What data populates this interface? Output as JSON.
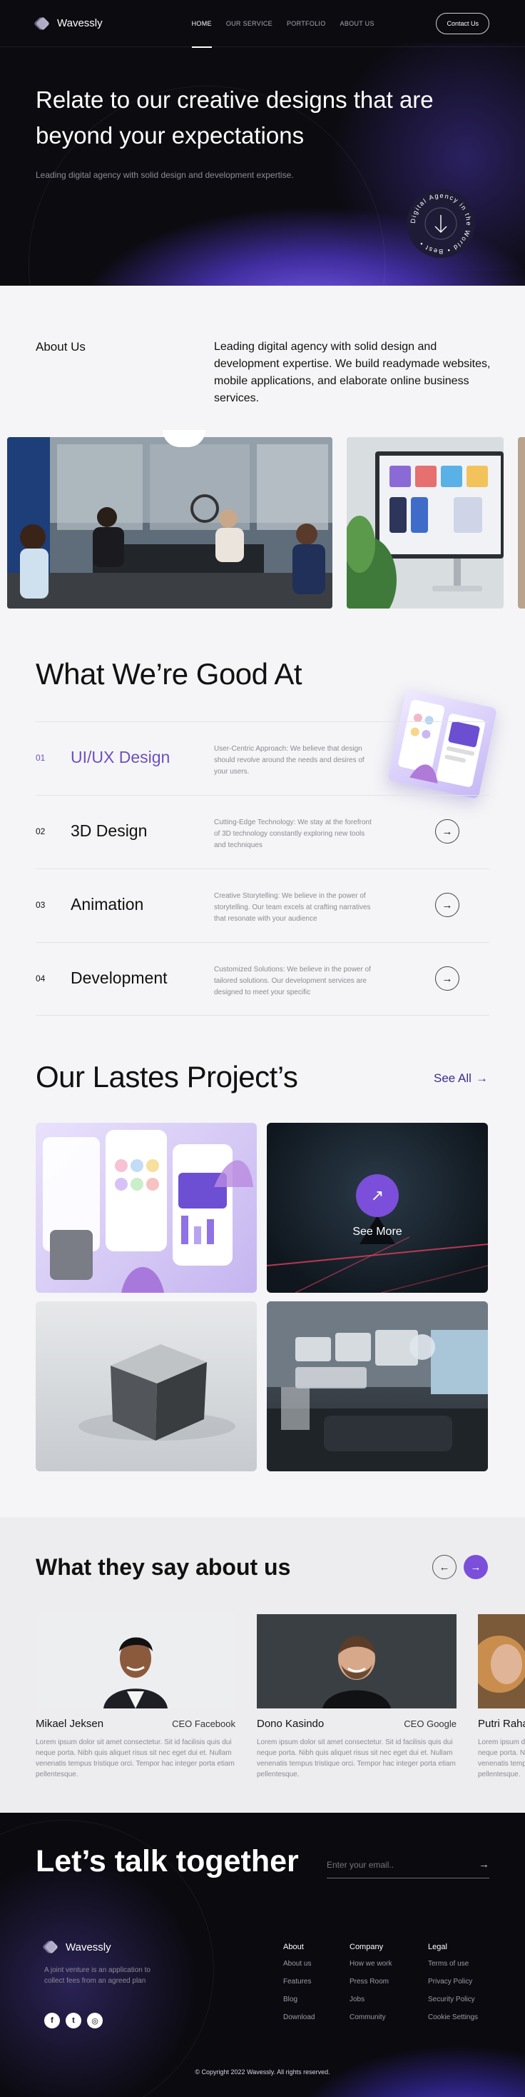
{
  "brand": {
    "name": "Wavessly"
  },
  "nav": {
    "items": [
      {
        "label": "HOME",
        "active": true
      },
      {
        "label": "OUR SERVICE",
        "active": false
      },
      {
        "label": "PORTFOLIO",
        "active": false
      },
      {
        "label": "ABOUT US",
        "active": false
      }
    ],
    "contact_label": "Contact Us"
  },
  "hero": {
    "title": "Relate to our creative designs that are beyond your expectations",
    "subtitle": "Leading digital agency with solid design and development expertise.",
    "badge_text": "Digital Agency in the World • Best •"
  },
  "about": {
    "label": "About Us",
    "text": "Leading digital agency with solid design and development expertise. We build readymade websites, mobile applications, and elaborate online business services."
  },
  "services": {
    "title": "What We’re Good At",
    "items": [
      {
        "num": "01",
        "name": "UI/UX Design",
        "desc": "User-Centric Approach: We believe that design should revolve around the needs and desires of your users.",
        "active": true
      },
      {
        "num": "02",
        "name": "3D Design",
        "desc": "Cutting-Edge Technology: We stay at the forefront of 3D technology constantly exploring new tools and techniques",
        "active": false
      },
      {
        "num": "03",
        "name": "Animation",
        "desc": "Creative Storytelling: We believe in the power of storytelling. Our team excels at crafting narratives that resonate with your audience",
        "active": false
      },
      {
        "num": "04",
        "name": "Development",
        "desc": "Customized Solutions: We believe in the power of tailored solutions. Our development services are designed to meet your specific",
        "active": false
      }
    ]
  },
  "projects": {
    "title": "Our Lastes Project’s",
    "see_all": "See All",
    "see_more": "See More"
  },
  "testimonials": {
    "title": "What they say about us",
    "items": [
      {
        "name": "Mikael Jeksen",
        "role": "CEO Facebook",
        "text": "Lorem ipsum dolor sit amet consectetur. Sit id facilisis quis dui neque porta. Nibh quis aliquet risus sit nec eget dui et. Nullam venenatis tempus tristique orci. Tempor hac integer porta etiam pellentesque."
      },
      {
        "name": "Dono Kasindo",
        "role": "CEO Google",
        "text": "Lorem ipsum dolor sit amet consectetur. Sit id facilisis quis dui neque porta. Nibh quis aliquet risus sit nec eget dui et. Nullam venenatis tempus tristique orci. Tempor hac integer porta etiam pellentesque."
      },
      {
        "name": "Putri Rahayu",
        "role": "",
        "text": "Lorem ipsum dolor sit amet consectetur. Sit id facilisis quis dui neque porta. Nibh quis aliquet risus sit nec eget dui et. Nullam venenatis tempus tristique orci. Tempor hac integer porta etiam pellentesque."
      }
    ]
  },
  "footer": {
    "cta": "Let’s talk together",
    "email_placeholder": "Enter your email..",
    "tagline": "A joint venture is an application to collect fees from an agreed plan",
    "columns": [
      {
        "title": "About",
        "links": [
          "About us",
          "Features",
          "Blog",
          "Download"
        ]
      },
      {
        "title": "Company",
        "links": [
          "How we work",
          "Press Room",
          "Jobs",
          "Community"
        ]
      },
      {
        "title": "Legal",
        "links": [
          "Terms of use",
          "Privacy Policy",
          "Security Policy",
          "Cookie Settings"
        ]
      }
    ],
    "socials": [
      {
        "icon": "facebook-icon",
        "glyph": "f"
      },
      {
        "icon": "twitter-icon",
        "glyph": "t"
      },
      {
        "icon": "instagram-icon",
        "glyph": "◎"
      }
    ],
    "copyright": "© Copyright 2022 Wavessly. All rights reserved."
  },
  "colors": {
    "accent": "#7b4fd9",
    "accent_dark": "#3b2d8c",
    "hero_bg": "#0c0b10"
  }
}
